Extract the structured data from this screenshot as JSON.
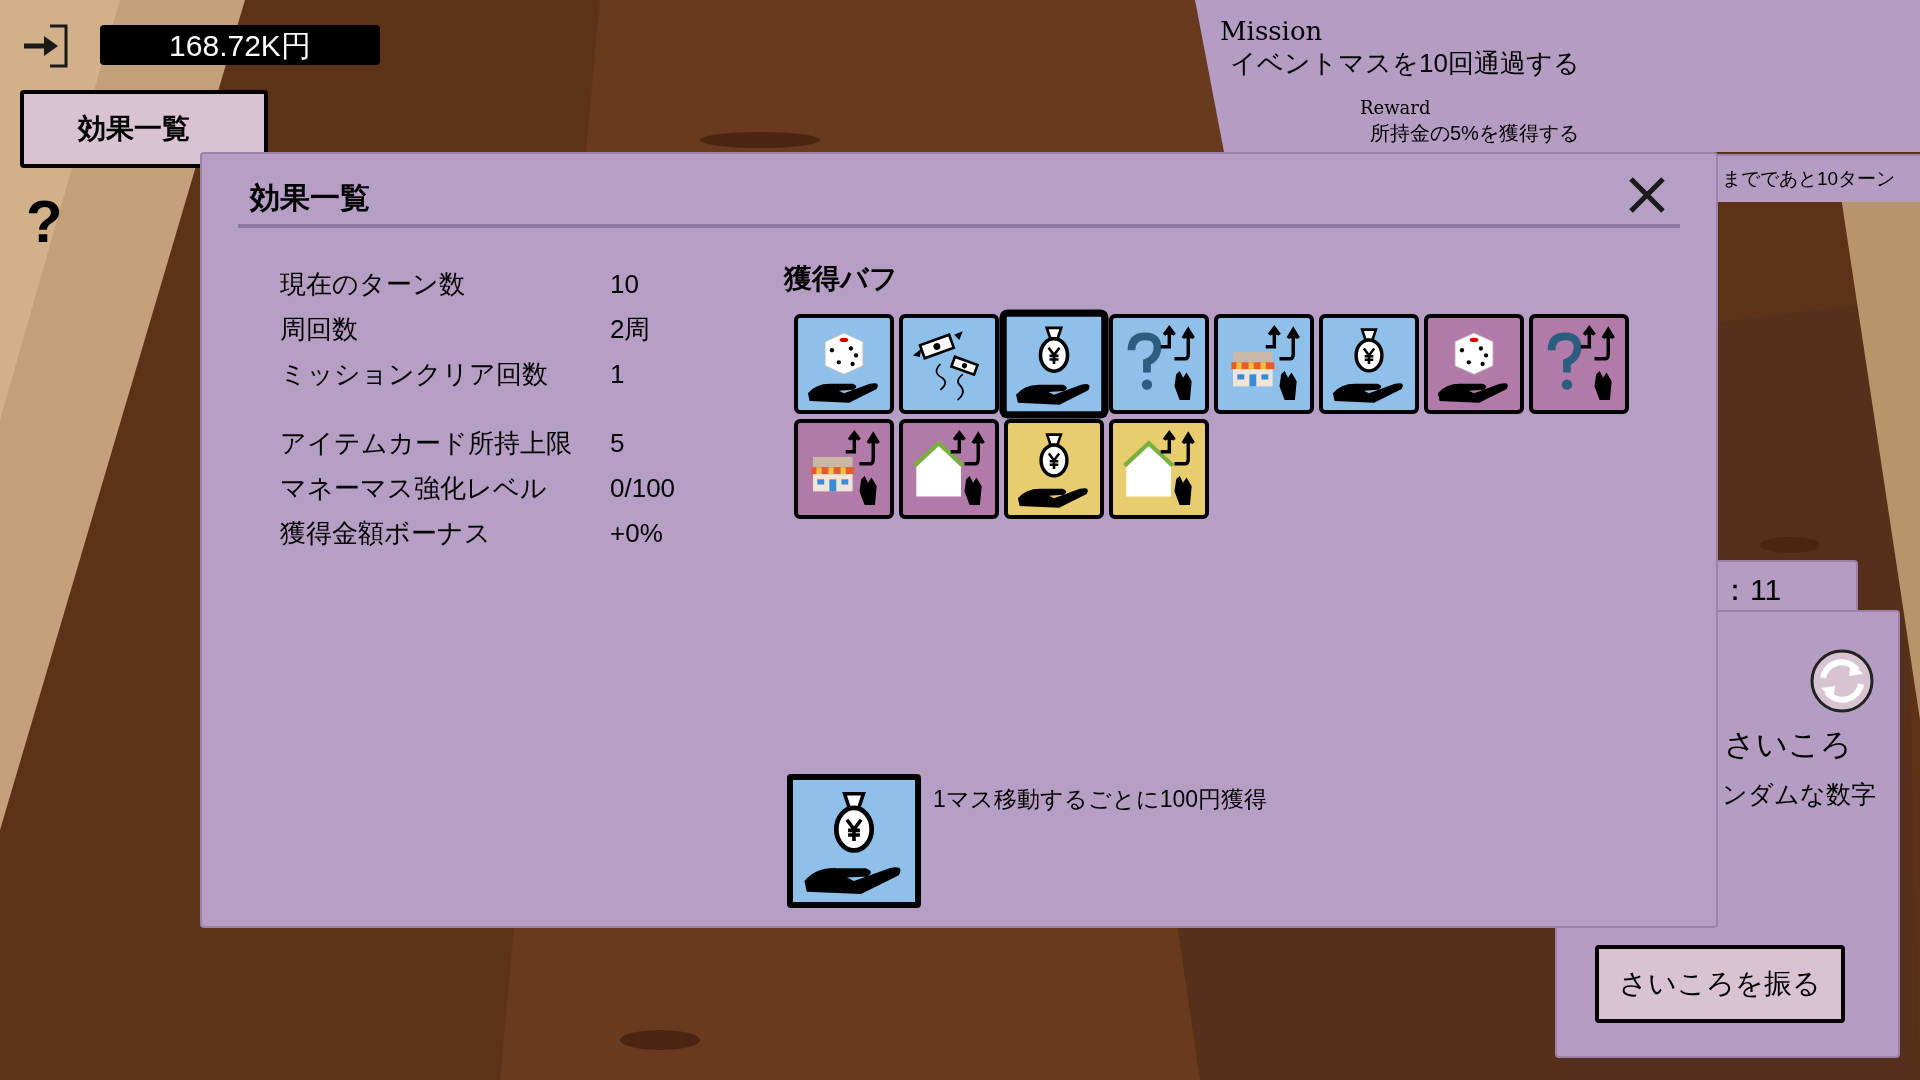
{
  "header": {
    "money": "168.72K円"
  },
  "effects_button": {
    "label": "効果一覧"
  },
  "help": {
    "label": "?"
  },
  "mission": {
    "heading": "Mission",
    "text": "イベントマスを10回通過する",
    "reward_heading": "Reward",
    "reward": "所持金の5%を獲得する",
    "deadline": "までであと10ターン"
  },
  "turn_tab": {
    "label": "：11"
  },
  "dice_panel": {
    "title": "さいころ",
    "description": "ンダムな数字",
    "button": "さいころを振る"
  },
  "dialog": {
    "title": "効果一覧",
    "stat_groups": [
      [
        {
          "label": "現在のターン数",
          "value": "10"
        },
        {
          "label": "周回数",
          "value": "2周"
        },
        {
          "label": "ミッションクリア回数",
          "value": "1"
        }
      ],
      [
        {
          "label": "アイテムカード所持上限",
          "value": "5"
        },
        {
          "label": "マネーマス強化レベル",
          "value": "0/100"
        },
        {
          "label": "獲得金額ボーナス",
          "value": "+0%"
        }
      ]
    ],
    "buffs_heading": "獲得バフ",
    "buffs": [
      {
        "kind": "dice",
        "color": "#8fc0ea",
        "selected": false
      },
      {
        "kind": "bills",
        "color": "#8fc0ea",
        "selected": false
      },
      {
        "kind": "yen",
        "color": "#8fc0ea",
        "selected": true
      },
      {
        "kind": "question",
        "color": "#8fc0ea",
        "selected": false
      },
      {
        "kind": "shop",
        "color": "#8fc0ea",
        "selected": false
      },
      {
        "kind": "yen",
        "color": "#8fc0ea",
        "selected": false
      },
      {
        "kind": "dice",
        "color": "#b27aa8",
        "selected": false
      },
      {
        "kind": "question",
        "color": "#b27aa8",
        "selected": false
      },
      {
        "kind": "shop",
        "color": "#b27aa8",
        "selected": false
      },
      {
        "kind": "house",
        "color": "#b27aa8",
        "selected": false
      },
      {
        "kind": "yen",
        "color": "#e8cd70",
        "selected": false
      },
      {
        "kind": "house",
        "color": "#e8cd70",
        "selected": false
      }
    ],
    "detail": {
      "kind": "yen",
      "color": "#8fc0ea",
      "description": "1マス移動するごとに100円獲得"
    }
  }
}
